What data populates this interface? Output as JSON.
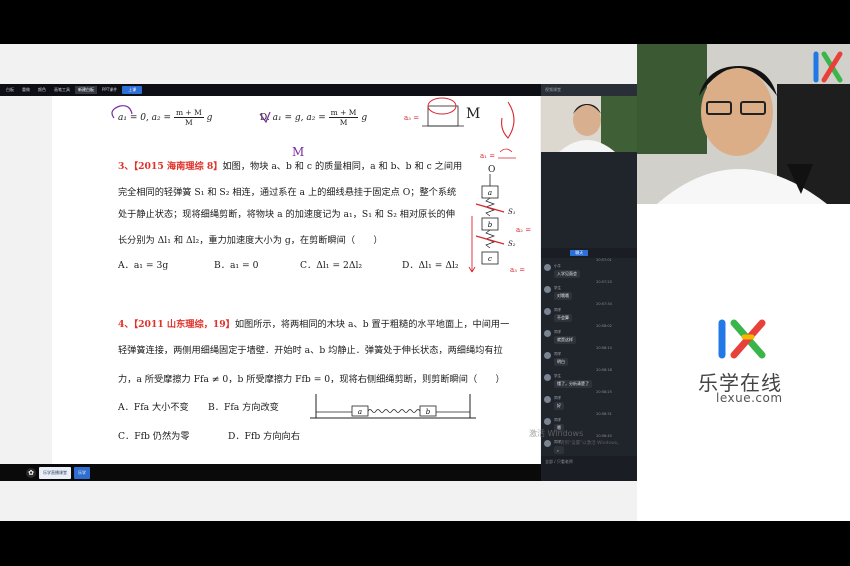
{
  "toolbar": {
    "items": [
      "白板",
      "重做",
      "颜色",
      "画笔工具",
      "新建白板",
      "PPT课件",
      "上课"
    ]
  },
  "doc": {
    "prev_options": {
      "c_formula": "a₁ = 0, a₂ =",
      "c_frac_top": "m + M",
      "c_frac_bot": "M",
      "c_g": "g",
      "d_label": "D.",
      "d_formula": "a₁ = g, a₂ =",
      "d_frac_top": "m + M",
      "d_frac_bot": "M",
      "d_g": "g"
    },
    "q3": {
      "num": "3、【2015 海南理综 8】",
      "line1": "如图，物块 a、b 和 c 的质量相同，a 和 b、b 和 c 之间用",
      "line2": "完全相同的轻弹簧 S₁ 和 S₂ 相连，通过系在 a 上的细线悬挂于固定点 O；整个系统",
      "line3": "处于静止状态；现将细绳剪断，将物块 a 的加速度记为 a₁，S₁ 和 S₂ 相对原长的伸",
      "line4": "长分别为 Δl₁ 和 Δl₂，重力加速度大小为 g，在剪断瞬间（　　）",
      "options": [
        "A．a₁ = 3g",
        "B．a₁ = 0",
        "C．Δl₁ = 2Δl₂",
        "D．Δl₁ = Δl₂"
      ]
    },
    "q4": {
      "num": "4、【2011 山东理综，19】",
      "line1": "如图所示，将两相同的木块 a、b 置于粗糙的水平地面上，中间用一",
      "line2": "轻弹簧连接，两侧用细绳固定于墙壁．开始时 a、b 均静止．弹簧处于伸长状态，两细绳均有拉",
      "line3": "力，a 所受摩擦力 Ffa ≠ 0，b 所受摩擦力 Ffb = 0，现将右侧细绳剪断，则剪断瞬间（　　）",
      "options": [
        "A．Ffa 大小不变",
        "B．Ffa 方向改变",
        "C．Ffb 仍然为零",
        "D．Ffb 方向向右"
      ],
      "block_a": "a",
      "block_b": "b"
    },
    "annotations": {
      "m_top": "M",
      "m_mid": "M",
      "a3_note": "a₃ =",
      "a1_note": "a₁ =",
      "a3_side": "a₃ =",
      "a2_side": "a₂ =",
      "o_label": "O",
      "a_lbl": "a",
      "b_lbl": "b",
      "c_lbl": "c",
      "s1_lbl": "S₁",
      "s2_lbl": "S₂"
    }
  },
  "sidepanel": {
    "title": "视频课堂",
    "tabs": [
      "",
      "聊天",
      "",
      ""
    ],
    "chat": [
      {
        "time": "20:57:01",
        "name": "小牛",
        "msg": "入学见面会"
      },
      {
        "time": "20:57:20",
        "name": "学生",
        "msg": "对哦哦"
      },
      {
        "time": "20:57:34",
        "name": "同学",
        "msg": "不会算"
      },
      {
        "time": "20:58:02",
        "name": "同学",
        "msg": "就是这样"
      },
      {
        "time": "20:58:10",
        "name": "同学",
        "msg": "明白"
      },
      {
        "time": "20:58:18",
        "name": "学生",
        "msg": "懂了，分析清楚了"
      },
      {
        "time": "20:58:25",
        "name": "同学",
        "msg": "好"
      },
      {
        "time": "20:58:31",
        "name": "同学",
        "msg": "嗯"
      },
      {
        "time": "20:58:40",
        "name": "同学",
        "msg": "。"
      }
    ],
    "input_label": "全部 / 只看老师"
  },
  "watermark": {
    "line1": "激活 Windows",
    "line2": "转到\"设置\"以激活 Windows。"
  },
  "taskbar": {
    "tab1": "乐学直播课堂",
    "tab2": "乐学"
  },
  "brand": {
    "cn": "乐学在线",
    "en": "lexue.com"
  },
  "colors": {
    "accent": "#2c6fd6",
    "question_number": "#e0322a",
    "pen_red": "#d9262e",
    "pen_purple": "#7b2d9f",
    "brand_blue": "#2178e6",
    "brand_green": "#39b54a",
    "brand_red": "#e8413a",
    "brand_yellow": "#f5b800"
  }
}
